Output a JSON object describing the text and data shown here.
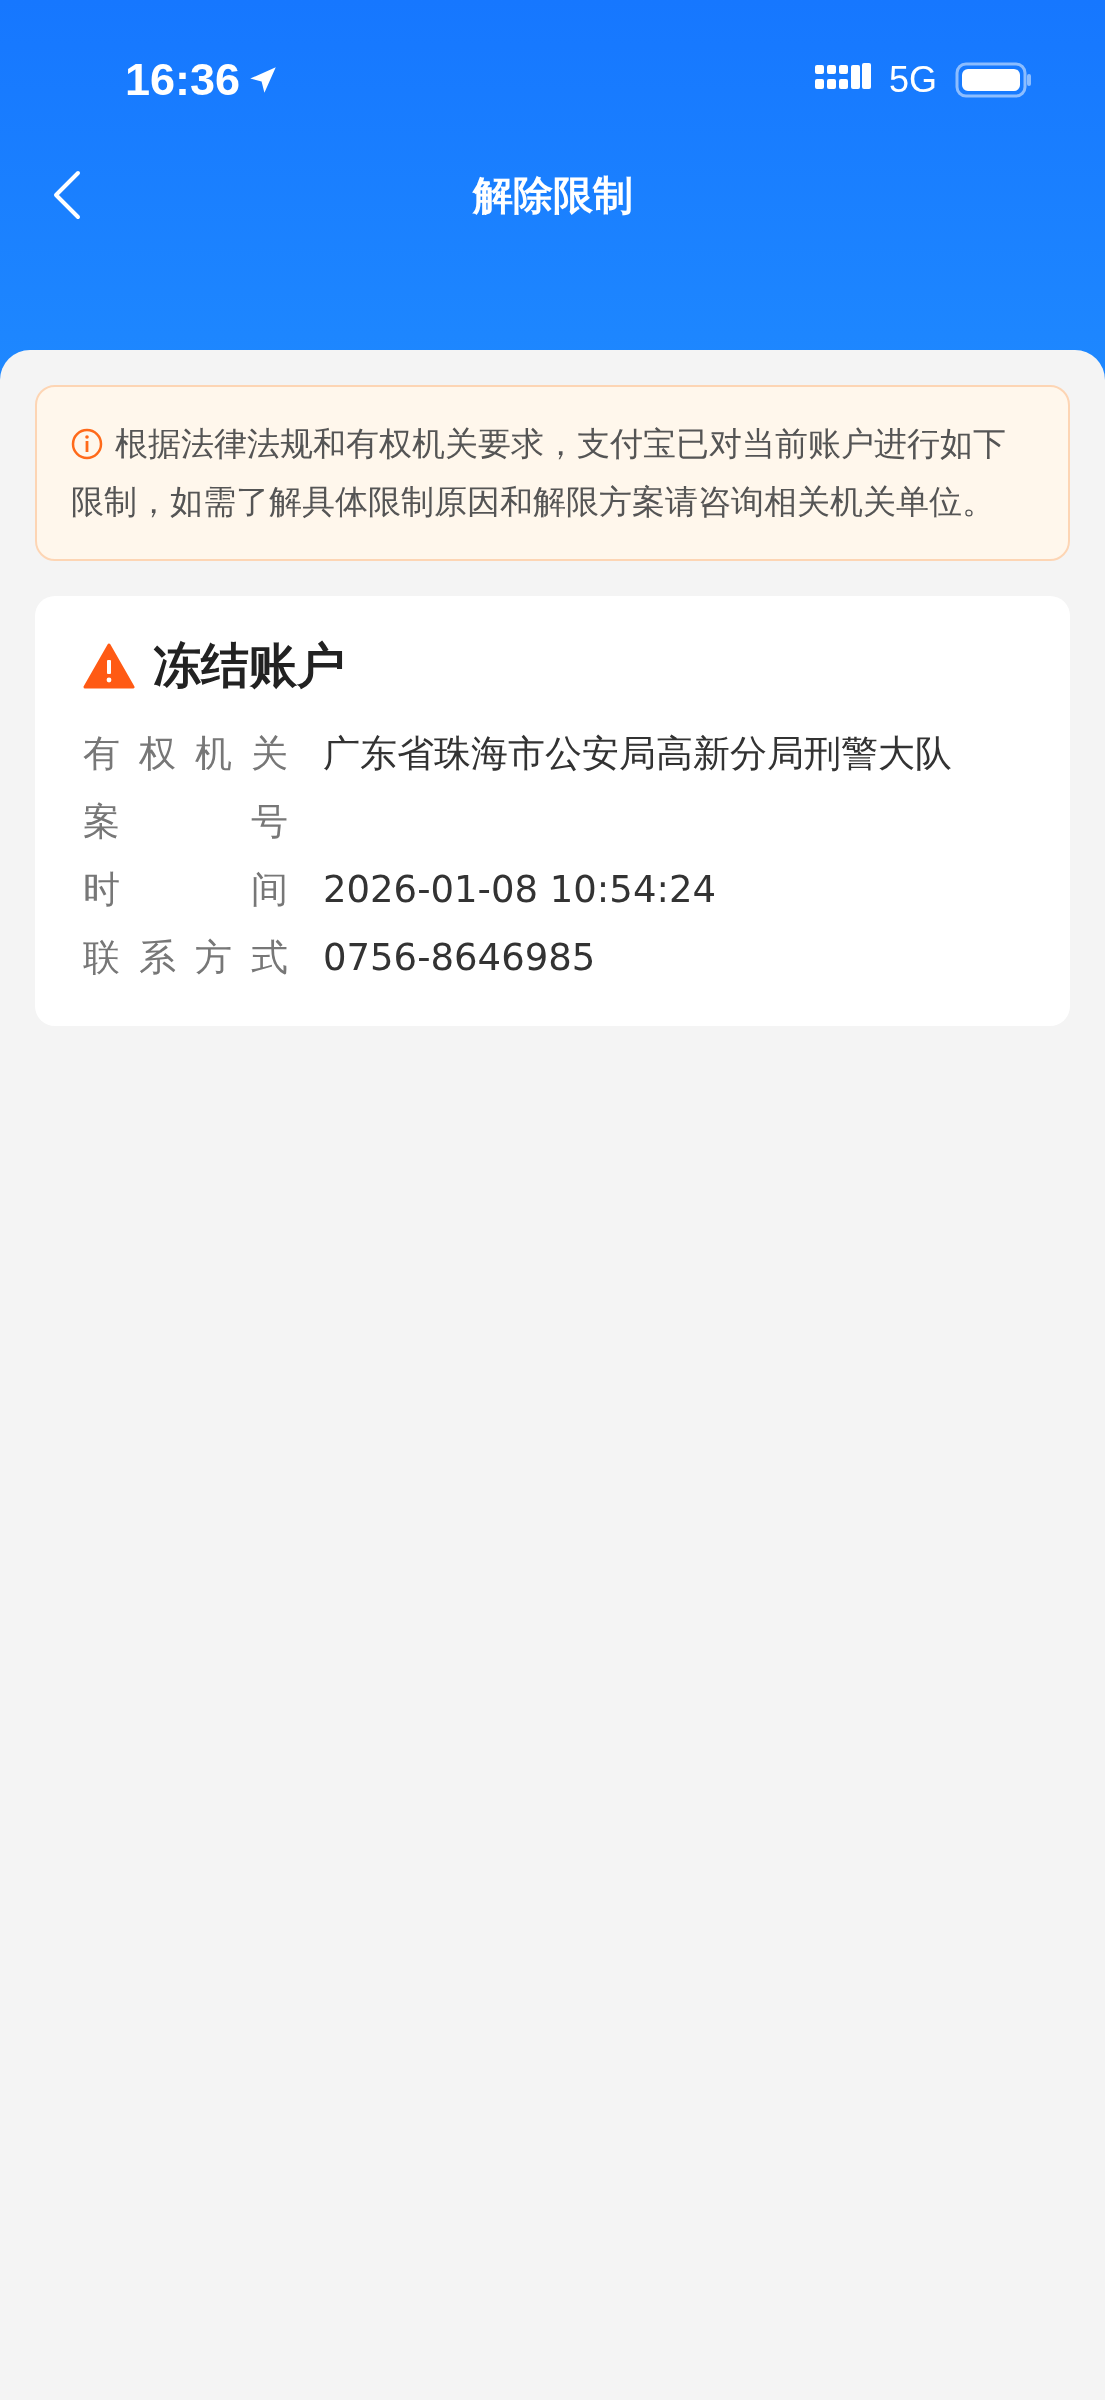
{
  "status_bar": {
    "time": "16:36",
    "network": "5G"
  },
  "header": {
    "title": "解除限制"
  },
  "notice": {
    "text": "根据法律法规和有权机关要求，支付宝已对当前账户进行如下限制，如需了解具体限制原因和解限方案请咨询相关机关单位。"
  },
  "restriction": {
    "title": "冻结账户",
    "rows": [
      {
        "label": "有权机关",
        "value": "广东省珠海市公安局高新分局刑警大队"
      },
      {
        "label": "案号"
      },
      {
        "label": "时间",
        "value": "2026-01-08 10:54:24"
      },
      {
        "label": "联系方式",
        "value": "0756-8646985"
      }
    ]
  }
}
